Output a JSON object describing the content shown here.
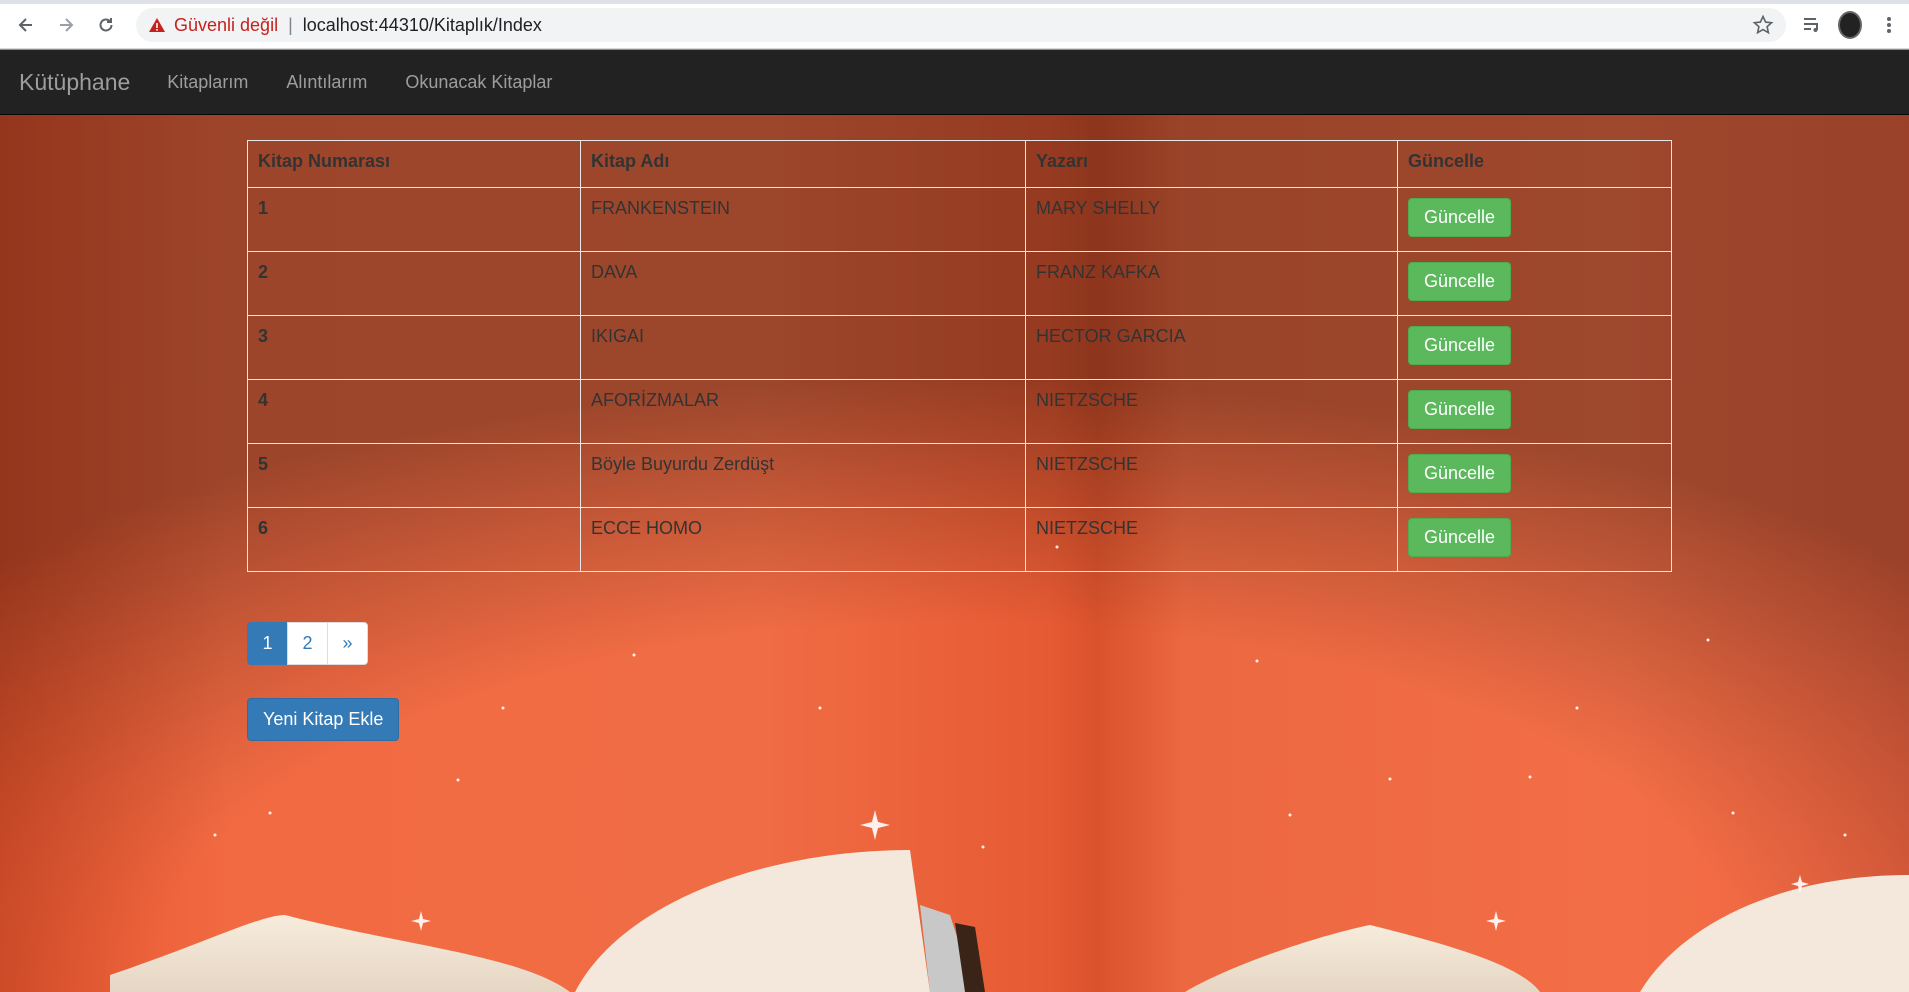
{
  "browser": {
    "security_label": "Güvenli değil",
    "separator": "|",
    "url": "localhost:44310/Kitaplık/Index"
  },
  "navbar": {
    "brand": "Kütüphane",
    "links": [
      "Kitaplarım",
      "Alıntılarım",
      "Okunacak Kitaplar"
    ]
  },
  "table": {
    "headers": [
      "Kitap Numarası",
      "Kitap Adı",
      "Yazarı",
      "Güncelle"
    ],
    "rows": [
      {
        "num": "1",
        "title": "FRANKENSTEIN",
        "author": "MARY SHELLY",
        "action": "Güncelle"
      },
      {
        "num": "2",
        "title": "DAVA",
        "author": "FRANZ KAFKA",
        "action": "Güncelle"
      },
      {
        "num": "3",
        "title": "IKIGAI",
        "author": "HECTOR GARCIA",
        "action": "Güncelle"
      },
      {
        "num": "4",
        "title": "AFORİZMALAR",
        "author": "NIETZSCHE",
        "action": "Güncelle"
      },
      {
        "num": "5",
        "title": "Böyle Buyurdu Zerdüşt",
        "author": "NIETZSCHE",
        "action": "Güncelle"
      },
      {
        "num": "6",
        "title": "ECCE HOMO",
        "author": "NIETZSCHE",
        "action": "Güncelle"
      }
    ]
  },
  "pagination": {
    "pages": [
      "1",
      "2"
    ],
    "next": "»",
    "active": "1"
  },
  "add_button": "Yeni Kitap Ekle",
  "colors": {
    "navbar_bg": "#222222",
    "success": "#5cb85c",
    "primary": "#337ab7",
    "background": "#ee6a40"
  }
}
